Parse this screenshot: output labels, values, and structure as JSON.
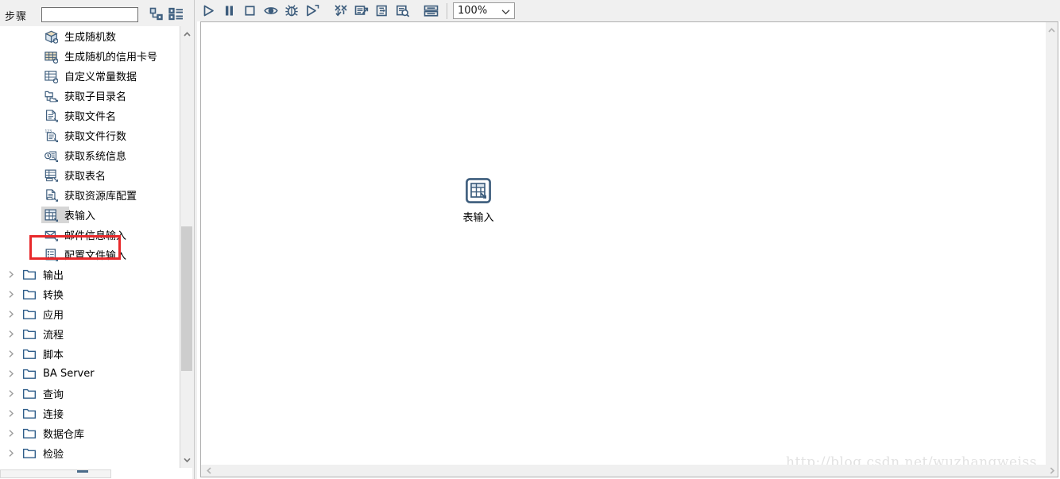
{
  "left_panel": {
    "header": {
      "steps_label": "步骤",
      "search_value": "",
      "search_placeholder": "",
      "tree_view_icon": "tree-view-icon",
      "list_view_icon": "list-view-icon"
    },
    "tree_items": [
      {
        "label": "生成随机数",
        "icon": "random-number-icon",
        "type": "leaf",
        "selected": false
      },
      {
        "label": "生成随机的信用卡号",
        "icon": "credit-card-icon",
        "type": "leaf",
        "selected": false
      },
      {
        "label": "自定义常量数据",
        "icon": "constant-data-icon",
        "type": "leaf",
        "selected": false
      },
      {
        "label": "获取子目录名",
        "icon": "subdirectory-icon",
        "type": "leaf",
        "selected": false
      },
      {
        "label": "获取文件名",
        "icon": "file-name-icon",
        "type": "leaf",
        "selected": false
      },
      {
        "label": "获取文件行数",
        "icon": "file-rowcount-icon",
        "type": "leaf",
        "selected": false
      },
      {
        "label": "获取系统信息",
        "icon": "system-info-icon",
        "type": "leaf",
        "selected": false
      },
      {
        "label": "获取表名",
        "icon": "table-name-icon",
        "type": "leaf",
        "selected": false
      },
      {
        "label": "获取资源库配置",
        "icon": "repository-config-icon",
        "type": "leaf",
        "selected": false
      },
      {
        "label": "表输入",
        "icon": "table-input-icon",
        "type": "leaf",
        "selected": true
      },
      {
        "label": "邮件信息输入",
        "icon": "mail-input-icon",
        "type": "leaf",
        "selected": false
      },
      {
        "label": "配置文件输入",
        "icon": "properties-input-icon",
        "type": "leaf",
        "selected": false
      },
      {
        "label": "输出",
        "icon": "folder-icon",
        "type": "folder",
        "selected": false
      },
      {
        "label": "转换",
        "icon": "folder-icon",
        "type": "folder",
        "selected": false
      },
      {
        "label": "应用",
        "icon": "folder-icon",
        "type": "folder",
        "selected": false
      },
      {
        "label": "流程",
        "icon": "folder-icon",
        "type": "folder",
        "selected": false
      },
      {
        "label": "脚本",
        "icon": "folder-icon",
        "type": "folder",
        "selected": false
      },
      {
        "label": "BA Server",
        "icon": "folder-icon",
        "type": "folder",
        "selected": false
      },
      {
        "label": "查询",
        "icon": "folder-icon",
        "type": "folder",
        "selected": false
      },
      {
        "label": "连接",
        "icon": "folder-icon",
        "type": "folder",
        "selected": false
      },
      {
        "label": "数据仓库",
        "icon": "folder-icon",
        "type": "folder",
        "selected": false
      },
      {
        "label": "检验",
        "icon": "folder-icon",
        "type": "folder",
        "selected": false
      }
    ],
    "annotation": {
      "color": "#e8282a",
      "target_label": "表输入"
    },
    "scrollbar": {
      "up_arrow_icon": "chevron-up-icon",
      "down_arrow_icon": "chevron-down-icon"
    }
  },
  "toolbar": {
    "buttons": [
      {
        "name": "run-button",
        "icon": "play-icon",
        "title": "运行"
      },
      {
        "name": "pause-button",
        "icon": "pause-icon",
        "title": "暂停"
      },
      {
        "name": "stop-button",
        "icon": "stop-icon",
        "title": "停止"
      },
      {
        "name": "preview-button",
        "icon": "eye-icon",
        "title": "预览"
      },
      {
        "name": "debug-button",
        "icon": "bug-icon",
        "title": "调试"
      },
      {
        "name": "replay-button",
        "icon": "play-outline-icon",
        "title": "重放"
      },
      {
        "name": "verify-button",
        "icon": "verify-icon",
        "title": "检验"
      },
      {
        "name": "impact-button",
        "icon": "impact-icon",
        "title": "影响分析"
      },
      {
        "name": "sql-button",
        "icon": "sql-icon",
        "title": "SQL"
      },
      {
        "name": "inspect-button",
        "icon": "inspect-icon",
        "title": "查看"
      },
      {
        "name": "grid-button",
        "icon": "grid-rows-icon",
        "title": "网格"
      }
    ],
    "zoom": {
      "value": "100%",
      "caret_icon": "chevron-down-icon"
    }
  },
  "canvas": {
    "node": {
      "label": "表输入",
      "icon": "table-input-node-icon"
    },
    "watermark": "http://blog.csdn.net/wuzhangweiss",
    "scroll": {
      "up_arrow_icon": "chevron-up-icon",
      "down_arrow_icon": "chevron-down-icon",
      "left_arrow_icon": "chevron-left-icon",
      "right_arrow_icon": "chevron-right-icon"
    }
  },
  "colors": {
    "panel_bg": "#f0f0f0",
    "canvas_bg": "#ffffff",
    "icon_blue": "#3c5c7c",
    "annotation_red": "#e8282a",
    "selection_gray": "#d6d6d6"
  }
}
